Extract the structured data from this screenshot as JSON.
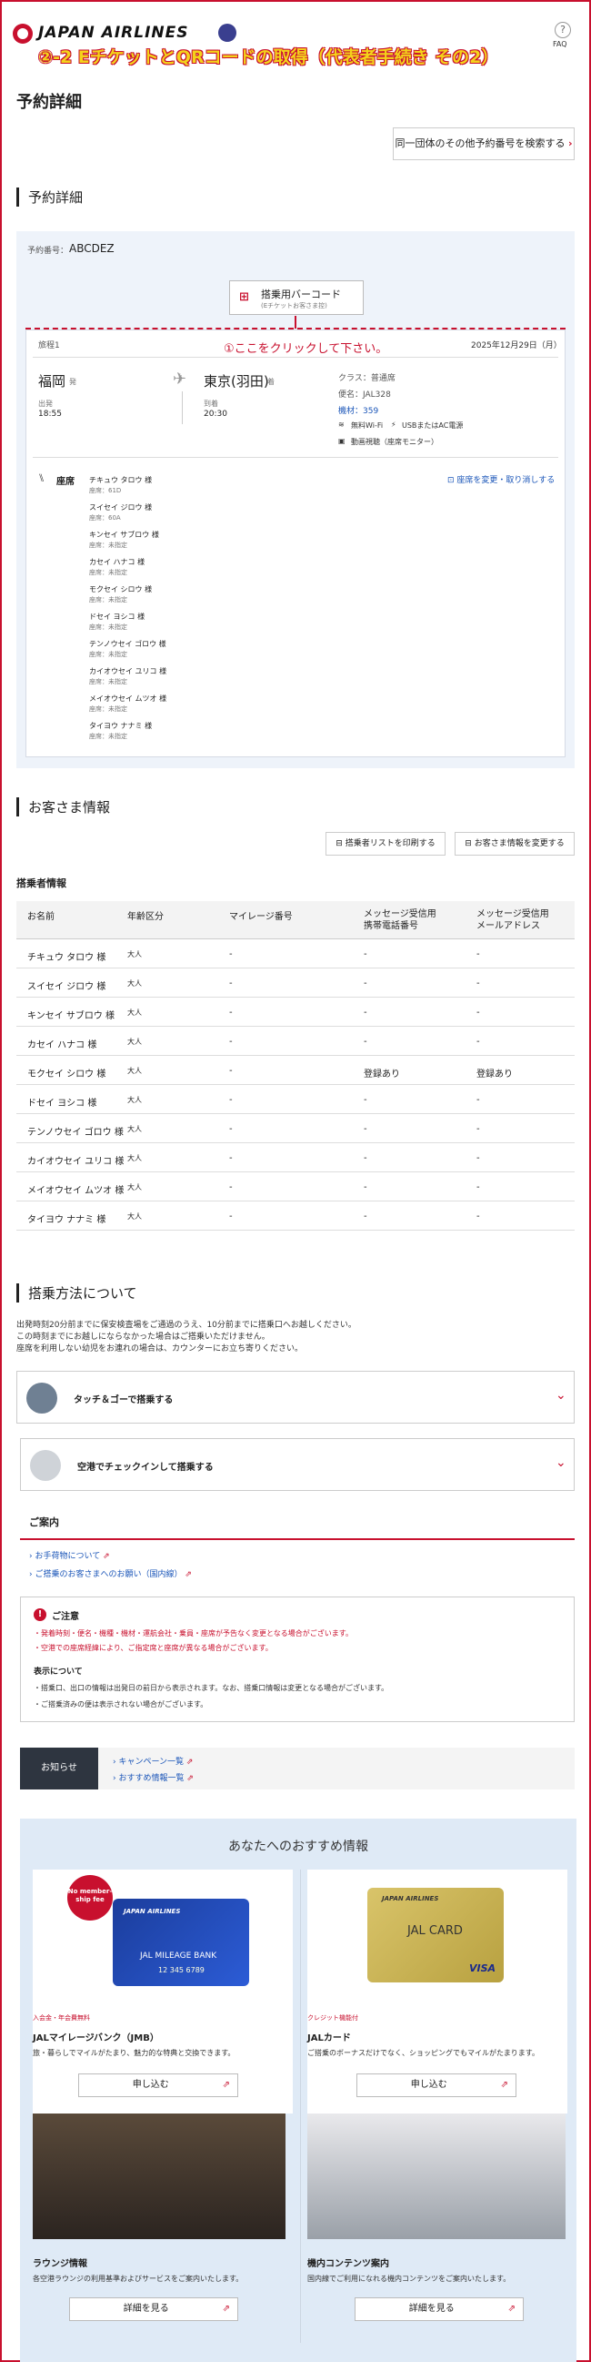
{
  "header": {
    "brand": "JAPAN AIRLINES",
    "banner": "②-2 EチケットとQRコードの取得（代表者手続き その2）",
    "faq": "FAQ"
  },
  "page_title": "予約詳細",
  "group_search_button": "同一団体のその他予約番号を検索する",
  "section_reservation": "予約詳細",
  "reservation": {
    "number_label": "予約番号：",
    "number_value": "ABCDEZ",
    "barcode_button": "搭乗用バーコード",
    "barcode_sub": "(Eチケットお客さま控)",
    "annotation": "①ここをクリックして下さい。",
    "itinerary_label": "旅程1",
    "date": "2025年12月29日（月）",
    "origin": "福岡",
    "origin_code": "発",
    "destination": "東京(羽田)",
    "destination_code": "着",
    "dep_label": "出発",
    "dep_time": "18:55",
    "arr_label": "到着",
    "arr_time": "20:30",
    "class": "クラス：普通席",
    "flight": "便名：JAL328",
    "aircraft": "機材：359",
    "wifi": "無料Wi-Fi",
    "power": "USBまたはAC電源",
    "video": "動画視聴（座席モニター）",
    "seat_label": "座席",
    "seat_change_link": "座席を変更・取り消しする",
    "seats": [
      {
        "name": "チキュウ タロウ 様",
        "seat": "座席：61D"
      },
      {
        "name": "スイセイ ジロウ 様",
        "seat": "座席：60A"
      },
      {
        "name": "キンセイ サブロウ 様",
        "seat": "座席：未指定"
      },
      {
        "name": "カセイ ハナコ 様",
        "seat": "座席：未指定"
      },
      {
        "name": "モクセイ シロウ 様",
        "seat": "座席：未指定"
      },
      {
        "name": "ドセイ ヨシコ 様",
        "seat": "座席：未指定"
      },
      {
        "name": "テンノウセイ ゴロウ 様",
        "seat": "座席：未指定"
      },
      {
        "name": "カイオウセイ ユリコ 様",
        "seat": "座席：未指定"
      },
      {
        "name": "メイオウセイ ムツオ 様",
        "seat": "座席：未指定"
      },
      {
        "name": "タイヨウ ナナミ 様",
        "seat": "座席：未指定"
      }
    ]
  },
  "section_customer": "お客さま情報",
  "print_list_button": "搭乗者リストを印刷する",
  "change_info_button": "お客さま情報を変更する",
  "passenger_heading": "搭乗者情報",
  "table": {
    "headers": [
      "お名前",
      "年齢区分",
      "マイレージ番号",
      "メッセージ受信用\n携帯電話番号",
      "メッセージ受信用\nメールアドレス"
    ],
    "rows": [
      [
        "チキュウ タロウ 様",
        "大人",
        "-",
        "-",
        "-"
      ],
      [
        "スイセイ ジロウ 様",
        "大人",
        "-",
        "-",
        "-"
      ],
      [
        "キンセイ サブロウ 様",
        "大人",
        "-",
        "-",
        "-"
      ],
      [
        "カセイ ハナコ 様",
        "大人",
        "-",
        "-",
        "-"
      ],
      [
        "モクセイ シロウ 様",
        "大人",
        "-",
        "登録あり",
        "登録あり"
      ],
      [
        "ドセイ ヨシコ 様",
        "大人",
        "-",
        "-",
        "-"
      ],
      [
        "テンノウセイ ゴロウ 様",
        "大人",
        "-",
        "-",
        "-"
      ],
      [
        "カイオウセイ ユリコ 様",
        "大人",
        "-",
        "-",
        "-"
      ],
      [
        "メイオウセイ ムツオ 様",
        "大人",
        "-",
        "-",
        "-"
      ],
      [
        "タイヨウ ナナミ 様",
        "大人",
        "-",
        "-",
        "-"
      ]
    ]
  },
  "section_boarding": "搭乗方法について",
  "boarding_text": [
    "出発時刻20分前までに保安検査場をご通過のうえ、10分前までに搭乗口へお越しください。",
    "この時刻までにお越しにならなかった場合はご搭乗いただけません。",
    "座席を利用しない幼児をお連れの場合は、カウンターにお立ち寄りください。"
  ],
  "accordion": [
    {
      "label": "タッチ＆ゴーで搭乗する"
    },
    {
      "label": "空港でチェックインして搭乗する"
    }
  ],
  "guide_title": "ご案内",
  "guide_links": [
    "お手荷物について",
    "ご搭乗のお客さまへのお願い（国内線）"
  ],
  "caution": {
    "title": "ご注意",
    "items": [
      "発着時刻・便名・機種・機材・運航会社・乗員・座席が予告なく変更となる場合がございます。",
      "空港での座席経緯により、ご指定席と座席が異なる場合がございます。"
    ],
    "display_title": "表示について",
    "display_items": [
      "搭乗口、出口の情報は出発日の前日から表示されます。なお、搭乗口情報は変更となる場合がございます。",
      "ご搭乗済みの便は表示されない場合がございます。"
    ]
  },
  "news": {
    "label": "お知らせ",
    "links": [
      "キャンペーン一覧",
      "おすすめ情報一覧"
    ]
  },
  "recommend": {
    "title": "あなたへのおすすめ情報",
    "cards": [
      {
        "tag": "入会金・年会費無料",
        "title": "JALマイレージバンク（JMB）",
        "desc": "旅・暮らしでマイルがたまり、魅力的な特典と交換できます。",
        "button": "申し込む",
        "badge": "No member-ship fee",
        "card_brand": "JAPAN AIRLINES",
        "card_name": "JAL MILEAGE BANK",
        "card_num": "12 345 6789"
      },
      {
        "tag": "クレジット機能付",
        "title": "JALカード",
        "desc": "ご搭乗のボーナスだけでなく、ショッピングでもマイルがたまります。",
        "button": "申し込む",
        "card_brand": "JAPAN AIRLINES",
        "card_name": "JAL CARD",
        "visa": "VISA"
      },
      {
        "title": "ラウンジ情報",
        "desc": "各空港ラウンジの利用基準およびサービスをご案内いたします。",
        "button": "詳細を見る"
      },
      {
        "title": "機内コンテンツ案内",
        "desc": "国内線でご利用になれる機内コンテンツをご案内いたします。",
        "button": "詳細を見る"
      }
    ]
  }
}
